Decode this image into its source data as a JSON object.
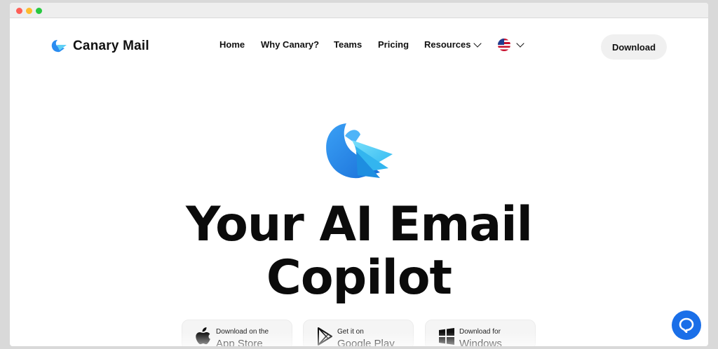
{
  "brand": {
    "name": "Canary Mail"
  },
  "nav": {
    "items": [
      {
        "label": "Home"
      },
      {
        "label": "Why Canary?"
      },
      {
        "label": "Teams"
      },
      {
        "label": "Pricing"
      },
      {
        "label": "Resources"
      }
    ],
    "language_icon": "us-flag-icon",
    "download_label": "Download"
  },
  "hero": {
    "headline_line1": "Your AI Email",
    "headline_line2": "Copilot"
  },
  "stores": [
    {
      "small": "Download on the",
      "big": "App Store",
      "icon": "apple-icon"
    },
    {
      "small": "Get it on",
      "big": "Google Play",
      "icon": "play-icon"
    },
    {
      "small": "Download for",
      "big": "Windows",
      "icon": "windows-icon"
    }
  ],
  "colors": {
    "accent": "#1a6fe8",
    "bird_primary": "#2a8cf0",
    "bird_light": "#5fd0f5"
  }
}
